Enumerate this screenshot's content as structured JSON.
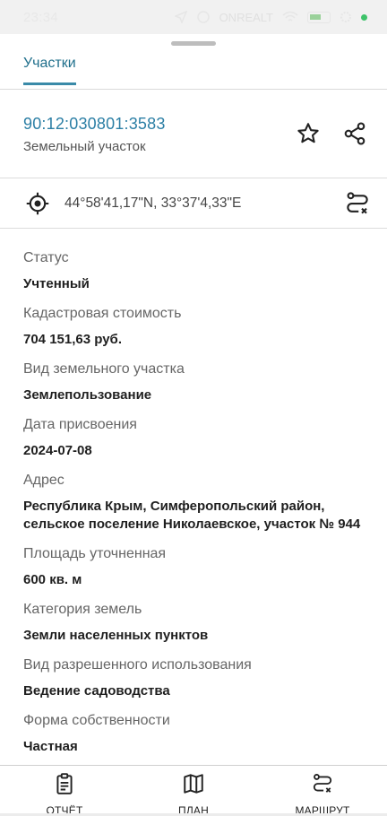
{
  "status_bar": {
    "time": "23:34",
    "watermark": "ONREALT"
  },
  "tabs": [
    {
      "label": "Участки"
    }
  ],
  "parcel": {
    "cadastral_number": "90:12:030801:3583",
    "type": "Земельный участок"
  },
  "coordinates": {
    "text": "44°58'41,17\"N, 33°37'4,33\"E"
  },
  "fields": [
    {
      "label": "Статус",
      "value": "Учтенный"
    },
    {
      "label": "Кадастровая стоимость",
      "value": "704 151,63 руб."
    },
    {
      "label": "Вид земельного участка",
      "value": "Землепользование"
    },
    {
      "label": "Дата присвоения",
      "value": "2024-07-08"
    },
    {
      "label": "Адрес",
      "value": "Республика Крым, Симферопольский район, сельское поселение Николаевское, участок № 944"
    },
    {
      "label": "Площадь уточненная",
      "value": "600 кв. м"
    },
    {
      "label": "Категория земель",
      "value": "Земли населенных пунктов"
    },
    {
      "label": "Вид разрешенного использования",
      "value": "Ведение садоводства"
    },
    {
      "label": "Форма собственности",
      "value": "Частная"
    }
  ],
  "bottom_nav": [
    {
      "label": "ОТЧЁТ",
      "icon": "report-icon"
    },
    {
      "label": "ПЛАН",
      "icon": "map-icon"
    },
    {
      "label": "МАРШРУТ",
      "icon": "route-icon"
    }
  ],
  "colors": {
    "accent": "#2c7fa5",
    "tab_indicator": "#3a8aa8"
  }
}
